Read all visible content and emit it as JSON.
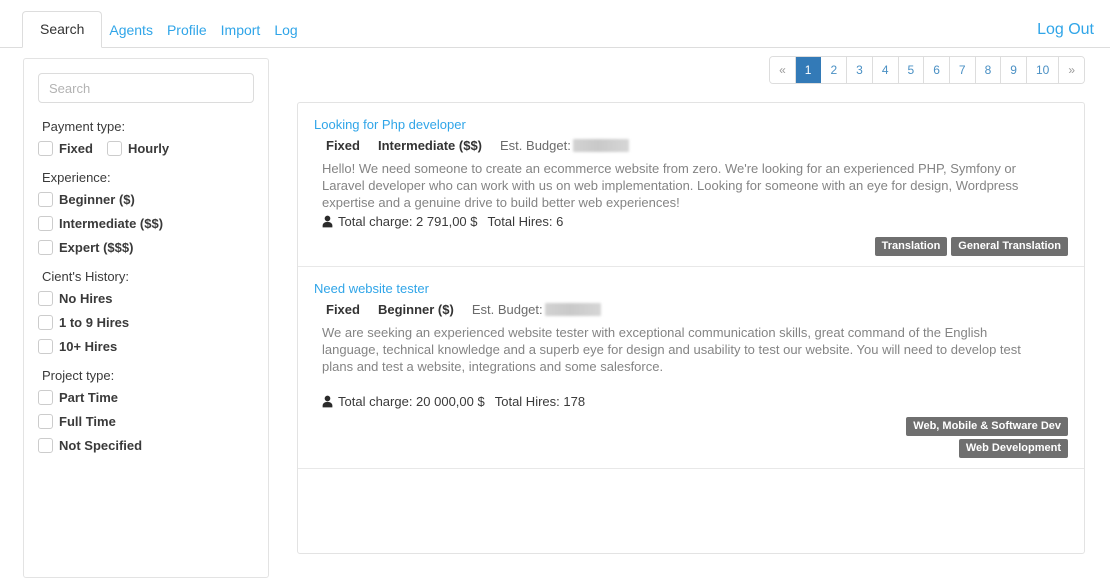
{
  "nav": {
    "tabs": [
      {
        "label": "Search",
        "active": true
      },
      {
        "label": "Agents",
        "active": false
      },
      {
        "label": "Profile",
        "active": false
      },
      {
        "label": "Import",
        "active": false
      },
      {
        "label": "Log",
        "active": false
      }
    ],
    "logout_label": "Log Out"
  },
  "sidebar": {
    "search": {
      "value": "",
      "placeholder": "Search"
    },
    "groups": [
      {
        "title": "Payment type:",
        "inline": true,
        "options": [
          {
            "label": "Fixed",
            "checked": false
          },
          {
            "label": "Hourly",
            "checked": false
          }
        ]
      },
      {
        "title": "Experience:",
        "inline": false,
        "options": [
          {
            "label": "Beginner ($)",
            "checked": false
          },
          {
            "label": "Intermediate ($$)",
            "checked": false
          },
          {
            "label": "Expert ($$$)",
            "checked": false
          }
        ]
      },
      {
        "title": "Cient's History:",
        "inline": false,
        "options": [
          {
            "label": "No Hires",
            "checked": false
          },
          {
            "label": "1 to 9 Hires",
            "checked": false
          },
          {
            "label": "10+ Hires",
            "checked": false
          }
        ]
      },
      {
        "title": "Project type:",
        "inline": false,
        "options": [
          {
            "label": "Part Time",
            "checked": false
          },
          {
            "label": "Full Time",
            "checked": false
          },
          {
            "label": "Not Specified",
            "checked": false
          }
        ]
      }
    ]
  },
  "pagination": {
    "prev_label": "«",
    "next_label": "»",
    "pages": [
      "1",
      "2",
      "3",
      "4",
      "5",
      "6",
      "7",
      "8",
      "9",
      "10"
    ],
    "active_page": "1",
    "prev_disabled": true
  },
  "jobs": [
    {
      "title": "Looking for Php developer",
      "payment_type": "Fixed",
      "experience": "Intermediate ($$)",
      "budget_label": "Est. Budget:",
      "budget_value": "",
      "budget_redacted": true,
      "description": "Hello! We need someone to create an ecommerce website  from zero. We're looking for an experienced PHP, Symfony or Laravel developer who can work with us on web implementation. Looking for someone with an eye for design, Wordpress expertise and a genuine drive to build better web experiences!",
      "total_charge": "Total charge: 2 791,00 $",
      "total_hires": "Total Hires: 6",
      "stats_spaced": false,
      "tag_rows": [
        [
          "Translation",
          "General Translation"
        ]
      ]
    },
    {
      "title": "Need website tester",
      "payment_type": "Fixed",
      "experience": "Beginner ($)",
      "budget_label": "Est. Budget:",
      "budget_value": "",
      "budget_redacted": true,
      "description": "We are seeking an experienced website tester with exceptional communication skills, great command of the English language, technical knowledge and a superb eye for design and usability to test our website. You will need to develop test plans and test a website, integrations and some salesforce.",
      "total_charge": "Total charge: 20 000,00 $",
      "total_hires": "Total Hires: 178",
      "stats_spaced": true,
      "tag_rows": [
        [
          "Web, Mobile & Software Dev"
        ],
        [
          "Web Development"
        ]
      ]
    },
    {
      "title": "",
      "payment_type": "",
      "experience": "",
      "budget_label": "",
      "budget_value": "",
      "budget_redacted": false,
      "description": "",
      "total_charge": "",
      "total_hires": "",
      "stats_spaced": false,
      "tag_rows": []
    }
  ],
  "colors": {
    "link_blue": "#30a5e8",
    "pager_active": "#337ab7",
    "tag_grey": "#6f6f6f",
    "border_grey": "#e3e3e3"
  }
}
